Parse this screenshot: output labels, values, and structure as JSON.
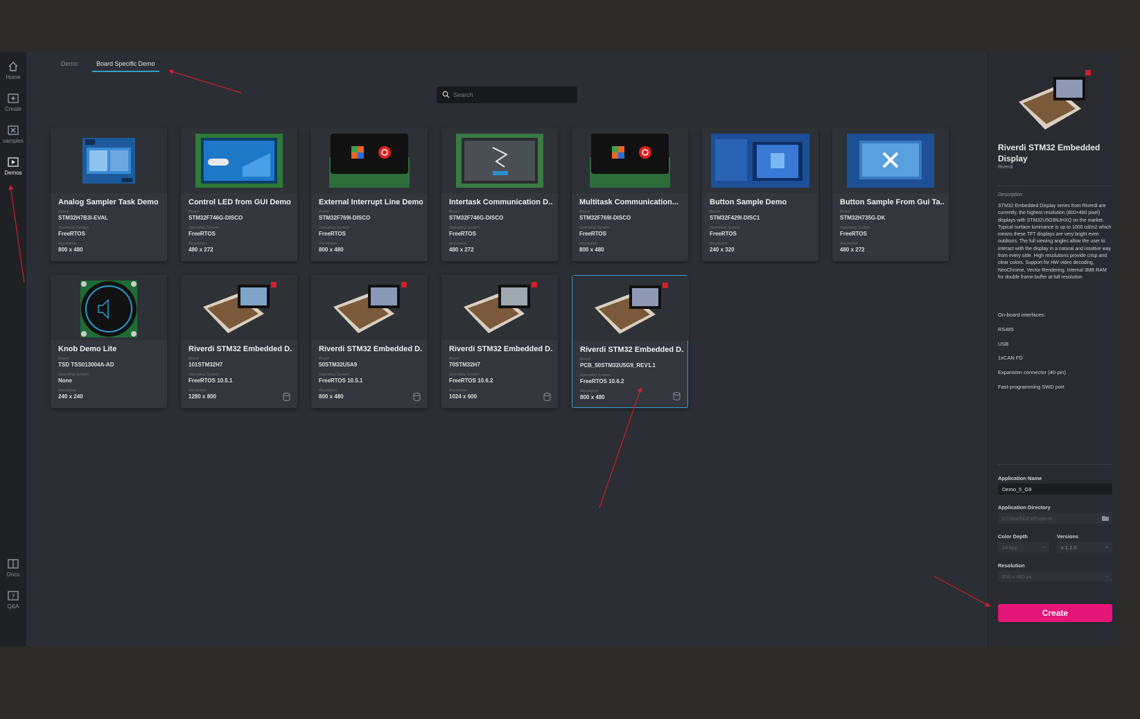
{
  "nav": {
    "items": [
      {
        "label": "Home",
        "icon": "home-icon"
      },
      {
        "label": "Create",
        "icon": "create-icon"
      },
      {
        "label": "xamples",
        "icon": "examples-icon"
      },
      {
        "label": "Demos",
        "icon": "demos-icon"
      },
      {
        "label": "Docs",
        "icon": "docs-icon"
      },
      {
        "label": "Q&A",
        "icon": "qa-icon"
      }
    ]
  },
  "tabs": [
    {
      "label": "Demo"
    },
    {
      "label": "Board Specific Demo"
    }
  ],
  "search": {
    "placeholder": "Search"
  },
  "field_labels": {
    "board": "Board",
    "os": "Operating System",
    "resolution": "Resolution"
  },
  "cards": [
    {
      "title": "Analog Sampler Task Demo",
      "board": "STM32H7B3I-EVAL",
      "os": "FreeRTOS",
      "resolution": "800 x 480"
    },
    {
      "title": "Control LED from GUI Demo",
      "board": "STM32F746G-DISCO",
      "os": "FreeRTOS",
      "resolution": "480 x 272"
    },
    {
      "title": "External Interrupt Line Demo",
      "board": "STM32F769I-DISCO",
      "os": "FreeRTOS",
      "resolution": "800 x 480"
    },
    {
      "title": "Intertask Communication D...",
      "board": "STM32F746G-DISCO",
      "os": "FreeRTOS",
      "resolution": "480 x 272"
    },
    {
      "title": "Multitask Communication...",
      "board": "STM32F769I-DISCO",
      "os": "FreeRTOS",
      "resolution": "800 x 480"
    },
    {
      "title": "Button Sample Demo",
      "board": "STM32F429I-DISC1",
      "os": "FreeRTOS",
      "resolution": "240 x 320"
    },
    {
      "title": "Button Sample From Gui Ta...",
      "board": "STM32H735G-DK",
      "os": "FreeRTOS",
      "resolution": "480 x 272"
    },
    {
      "title": "Knob Demo Lite",
      "board": "TSD TSS013004A-AD",
      "os": "None",
      "resolution": "240 x 240"
    },
    {
      "title": "Riverdi STM32 Embedded D...",
      "board": "101STM32H7",
      "os": "FreeRTOS 10.5.1",
      "resolution": "1280 x 800"
    },
    {
      "title": "Riverdi STM32 Embedded D...",
      "board": "50STM32U5A9",
      "os": "FreeRTOS 10.5.1",
      "resolution": "800 x 480"
    },
    {
      "title": "Riverdi STM32 Embedded D...",
      "board": "70STM32H7",
      "os": "FreeRTOS 10.6.2",
      "resolution": "1024 x 600"
    },
    {
      "title": "Riverdi STM32 Embedded D...",
      "board": "PCB_50STM32U5G9_REV1.1",
      "os": "FreeRTOS 10.6.2",
      "resolution": "800 x 480"
    }
  ],
  "panel": {
    "title": "Riverdi STM32 Embedded Display",
    "vendor": "Riverdi",
    "description_label": "Description",
    "description": "STM32 Embedded Display series from Riverdi are currently, the highest resolution (800×480 pixel) displays with STM32U5G9NJHXQ on the market. Typical surface luminance is up to 1000 cd/m2 which means these TFT displays are very bright even outdoors. The full viewing angles allow the user to interact with the display in a natural and intuitive way from every side. High resolutions provide crisp and clear colors. Support for HW video decoding, NeoChrome, Vector Rendering. Internal 3MB RAM for double frame buffer at full resolution",
    "interfaces_label": "On-board interfaces:",
    "interfaces": [
      "RS485",
      "USB",
      "1xCAN FD",
      "Expansion connector (40-pin)",
      "Fast-programming SWD port"
    ],
    "app_name_label": "Application Name",
    "app_name": "Demo_5_G9",
    "app_dir_label": "Application Directory",
    "app_dir": "C:\\TouchGFXProjects",
    "color_depth_label": "Color Depth",
    "color_depth": "24 bpp",
    "versions_label": "Versions",
    "version": "v 1.1.0",
    "resolution_label": "Resolution",
    "resolution": "800 x 480 px",
    "create_label": "Create"
  },
  "colors": {
    "accent": "#e5157a",
    "selected_border": "#3a9fd0",
    "annotation": "#d0212b"
  }
}
